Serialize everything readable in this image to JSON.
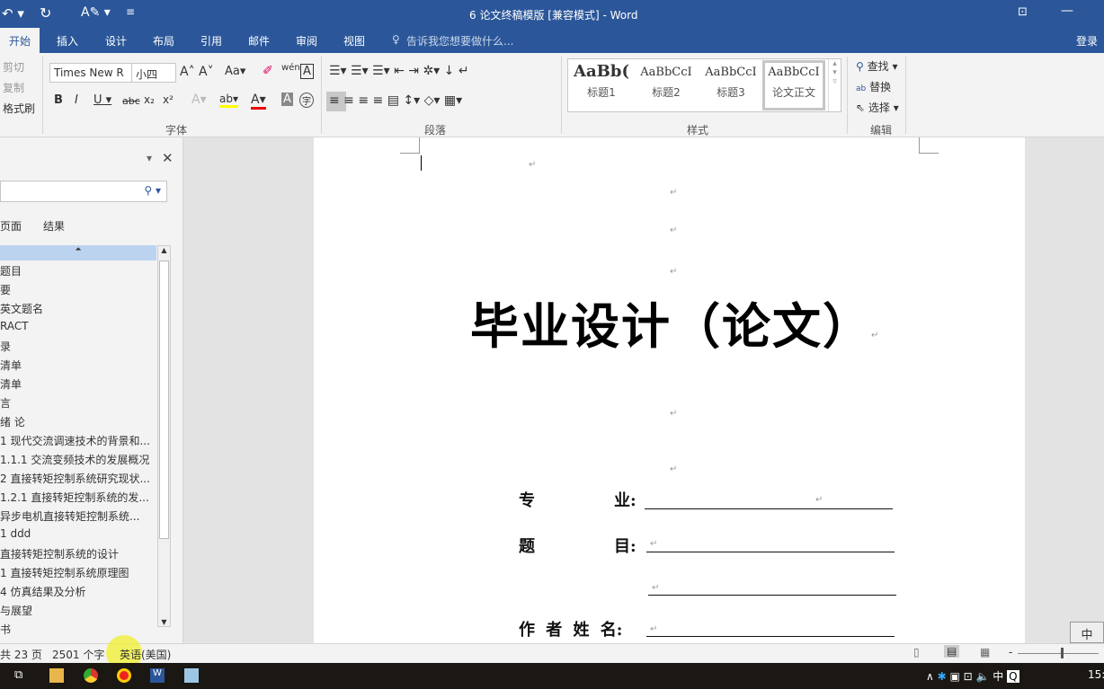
{
  "window": {
    "title": "6 论文终稿模版 [兼容模式] - Word",
    "login": "登录"
  },
  "tabs": [
    "开始",
    "插入",
    "设计",
    "布局",
    "引用",
    "邮件",
    "审阅",
    "视图"
  ],
  "tell_me": "告诉我您想要做什么...",
  "ribbon": {
    "clipboard": {
      "cut": "剪切",
      "copy": "复制",
      "format_painter": "格式刷"
    },
    "font": {
      "name": "Times New R",
      "size": "小四",
      "label": "字体"
    },
    "paragraph": {
      "label": "段落"
    },
    "styles": {
      "items": [
        "标题1",
        "标题2",
        "标题3",
        "论文正文"
      ],
      "previews": [
        "AaBb(",
        "AaBbCcI",
        "AaBbCcI",
        "AaBbCcI"
      ],
      "label": "样式"
    },
    "editing": {
      "find": "查找",
      "replace": "替换",
      "select": "选择",
      "label": "编辑"
    }
  },
  "nav": {
    "tabs": [
      "页面",
      "结果"
    ],
    "items": [
      "题目",
      "要",
      "英文题名",
      "RACT",
      "录",
      "清单",
      "清单",
      "言",
      "绪  论",
      "1 现代交流调速技术的背景和...",
      "1.1.1 交流变频技术的发展概况",
      "2 直接转矩控制系统研究现状...",
      "1.2.1 直接转矩控制系统的发...",
      "异步电机直接转矩控制系统...",
      "1 ddd",
      "直接转矩控制系统的设计",
      "1 直接转矩控制系统原理图",
      "4 仿真结果及分析",
      "与展望",
      "书"
    ]
  },
  "document": {
    "title": "毕业设计（论文）",
    "fields": [
      "专",
      "业:",
      "题",
      "目:",
      "作 者 姓 名:"
    ]
  },
  "status": {
    "pages": "共 23 页",
    "words": "2501 个字",
    "language": "英语(美国)"
  },
  "taskbar": {
    "ime": "中",
    "clock": "15:"
  },
  "colors": {
    "brand": "#2b579a"
  }
}
